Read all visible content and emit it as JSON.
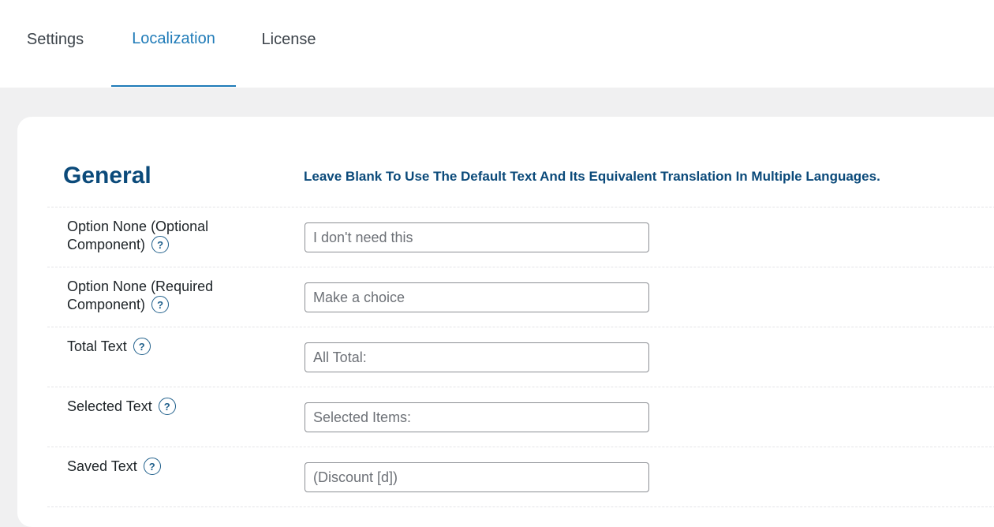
{
  "tabs": [
    {
      "label": "Settings",
      "active": false
    },
    {
      "label": "Localization",
      "active": true
    },
    {
      "label": "License",
      "active": false
    }
  ],
  "section": {
    "title": "General",
    "hint": "Leave Blank To Use The Default Text And Its Equivalent Translation In Multiple Languages."
  },
  "rows": [
    {
      "label_line1": "Option None (Optional",
      "label_line2": "Component)",
      "placeholder": "I don't need this",
      "value": ""
    },
    {
      "label_line1": "Option None (Required",
      "label_line2": "Component)",
      "placeholder": "Make a choice",
      "value": ""
    },
    {
      "label_line1": "Total Text",
      "placeholder": "All Total:",
      "value": ""
    },
    {
      "label_line1": "Selected Text",
      "placeholder": "Selected Items:",
      "value": ""
    },
    {
      "label_line1": "Saved Text",
      "placeholder": "(Discount [d])",
      "value": ""
    }
  ],
  "help_icon_glyph": "?",
  "colors": {
    "accent": "#1f7bb8",
    "heading": "#0b4a7a",
    "background": "#f0f0f1"
  }
}
